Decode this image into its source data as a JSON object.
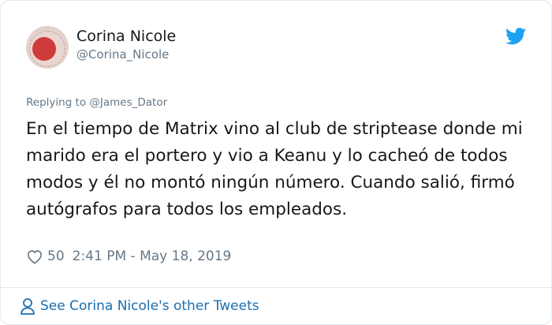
{
  "tweet": {
    "author_name": "Corina Nicole",
    "author_handle": "@Corina_Nicole",
    "replying_to": "Replying to @James_Dator",
    "text": "En el tiempo de Matrix vino al club de striptease donde mi marido era el portero y vio a Keanu y lo cacheó de todos modos y él no montó ningún número. Cuando salió, firmó autógrafos para todos los empleados.",
    "likes": "50",
    "timestamp": "2:41 PM - May 18, 2019"
  },
  "footer": {
    "link_label": "See Corina Nicole's other Tweets"
  },
  "icons": {
    "brand": "twitter-bird",
    "like": "heart-outline",
    "profile": "person-outline"
  },
  "colors": {
    "brand": "#1da1f2",
    "link": "#1b6fb0",
    "muted": "#657786",
    "text": "#14171a"
  }
}
